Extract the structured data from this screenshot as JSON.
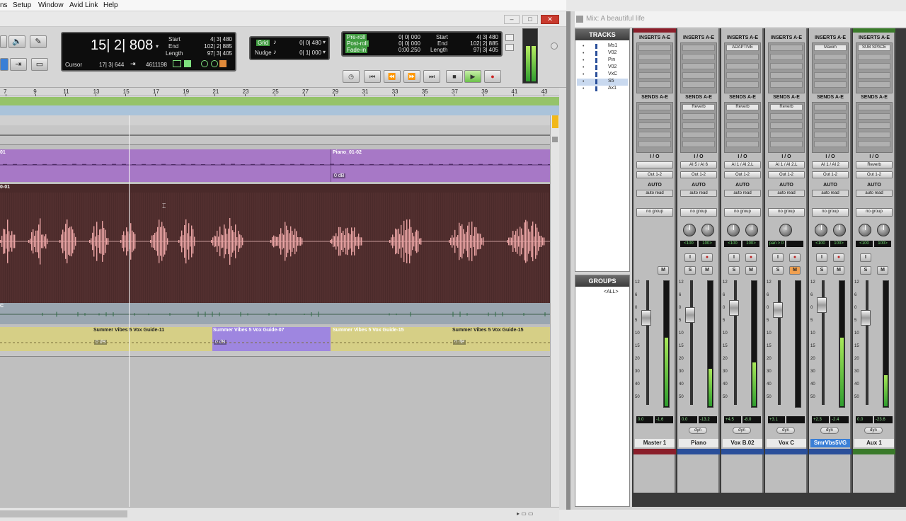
{
  "menu": [
    "ns",
    "Setup",
    "Window",
    "Avid Link",
    "Help"
  ],
  "edit": {
    "counter": "15| 2| 808",
    "counter_fields": [
      {
        "label": "Start",
        "value": "4| 3| 480"
      },
      {
        "label": "End",
        "value": "102| 2| 885"
      },
      {
        "label": "Length",
        "value": "97| 3| 405"
      }
    ],
    "cursor_label": "Cursor",
    "cursor_value": "17| 3| 644",
    "sample_value": "4611198",
    "grid_label": "Grid",
    "grid_value": "0| 0| 480",
    "nudge_label": "Nudge",
    "nudge_value": "0| 1| 000",
    "preroll_fields": [
      {
        "label": "Pre-roll",
        "value": "0| 0| 000"
      },
      {
        "label": "Post-roll",
        "value": "0| 0| 000"
      },
      {
        "label": "Fade-in",
        "value": "0:00.250"
      }
    ],
    "transport_fields": [
      {
        "label": "Start",
        "value": "4| 3| 480"
      },
      {
        "label": "End",
        "value": "102| 2| 885"
      },
      {
        "label": "Length",
        "value": "97| 3| 405"
      }
    ],
    "ruler_ticks": [
      "7",
      "9",
      "11",
      "13",
      "15",
      "17",
      "19",
      "21",
      "23",
      "25",
      "27",
      "29",
      "31",
      "33",
      "35",
      "37",
      "39",
      "41",
      "43"
    ],
    "tracks": [
      {
        "clip_left_label": "01",
        "clip_right_label": "Piano_01-02",
        "vol": "0 dB"
      },
      {
        "clip_left_label": "0-01"
      },
      {
        "clip_left_label": "C"
      },
      {
        "clips": [
          {
            "label": "Summer Vibes 5 Vox Guide-11",
            "vol": "0 dB"
          },
          {
            "label": "Summer Vibes 5 Vox Guide-07",
            "vol": "0 dB"
          },
          {
            "label": "Summer Vibes 5 Vox Guide-15",
            "vol": ""
          },
          {
            "label": "Summer Vibes 5 Vox Guide-15",
            "vol": "0 dB"
          }
        ]
      }
    ]
  },
  "mix": {
    "title": "Mix: A beautiful life",
    "tracks_header": "TRACKS",
    "groups_header": "GROUPS",
    "track_list": [
      "Ms1",
      "V02",
      "Pin",
      "V02",
      "VxC",
      "S5",
      "Ax1"
    ],
    "group_all": "<ALL>",
    "inserts_label": "INSERTS A-E",
    "sends_label": "SENDS A-E",
    "io_label": "I / O",
    "auto_label": "AUTO",
    "strips": [
      {
        "name": "Master 1",
        "color": "#8a1e2a",
        "top_color": "#8a1e2a",
        "insert": "",
        "send": "",
        "input": "",
        "output": "Out 1-2",
        "auto": "auto read",
        "group": "no group",
        "pan": [
          "",
          ""
        ],
        "level": "0.0",
        "peak": "-1.6",
        "meter": 0.55,
        "fader": 0.7,
        "selected": false
      },
      {
        "name": "Piano",
        "color": "#2a4f9a",
        "top_color": "",
        "insert": "",
        "send": "Reverb",
        "input": "AI 5 / AI 6",
        "output": "Out 1-2",
        "auto": "auto read",
        "group": "no group",
        "pan": [
          "<100",
          "100>"
        ],
        "level": "0.0",
        "peak": "-13.2",
        "meter": 0.3,
        "fader": 0.72,
        "selected": false
      },
      {
        "name": "Vox B.02",
        "color": "#2a4f9a",
        "top_color": "",
        "insert": "ADAPTIVE",
        "send": "Reverb",
        "input": "AI 1 / AI 2.L",
        "output": "Out 1-2",
        "auto": "auto read",
        "group": "no group",
        "pan": [
          "<100",
          "100>"
        ],
        "level": "+4.5",
        "peak": "-8.0",
        "meter": 0.35,
        "fader": 0.78,
        "selected": false
      },
      {
        "name": "Vox C",
        "color": "#2a4f9a",
        "top_color": "",
        "insert": "",
        "send": "Reverb",
        "input": "AI 1 / AI 2.L",
        "output": "Out 1-2",
        "auto": "auto read",
        "group": "no group",
        "pan": [
          "pan > 0 <",
          ""
        ],
        "level": "+3.1",
        "peak": "",
        "meter": 0.0,
        "fader": 0.76,
        "selected": false
      },
      {
        "name": "SmrVbs5VG",
        "color": "#2a4f9a",
        "top_color": "",
        "insert": "Maxim",
        "send": "",
        "input": "AI 1 / AI 2",
        "output": "Out 1-2",
        "auto": "auto read",
        "group": "no group",
        "pan": [
          "<100",
          "100>"
        ],
        "level": "+2.3",
        "peak": "-2.4",
        "meter": 0.55,
        "fader": 0.8,
        "selected": true
      },
      {
        "name": "Aux 1",
        "color": "#3a7a2a",
        "top_color": "#3a7a2a",
        "insert": "SUB SPACE",
        "send": "",
        "input": "Reverb",
        "output": "Out 1-2",
        "auto": "auto read",
        "group": "no group",
        "pan": [
          "<100",
          "100>"
        ],
        "level": "0.0",
        "peak": "-23.6",
        "meter": 0.25,
        "fader": 0.7,
        "selected": false
      }
    ],
    "scale": [
      "12",
      "6",
      "0",
      "5",
      "10",
      "15",
      "20",
      "30",
      "40",
      "50"
    ],
    "dyn_label": "dyn",
    "m_label": "M",
    "s_label": "S",
    "i_label": "I"
  }
}
